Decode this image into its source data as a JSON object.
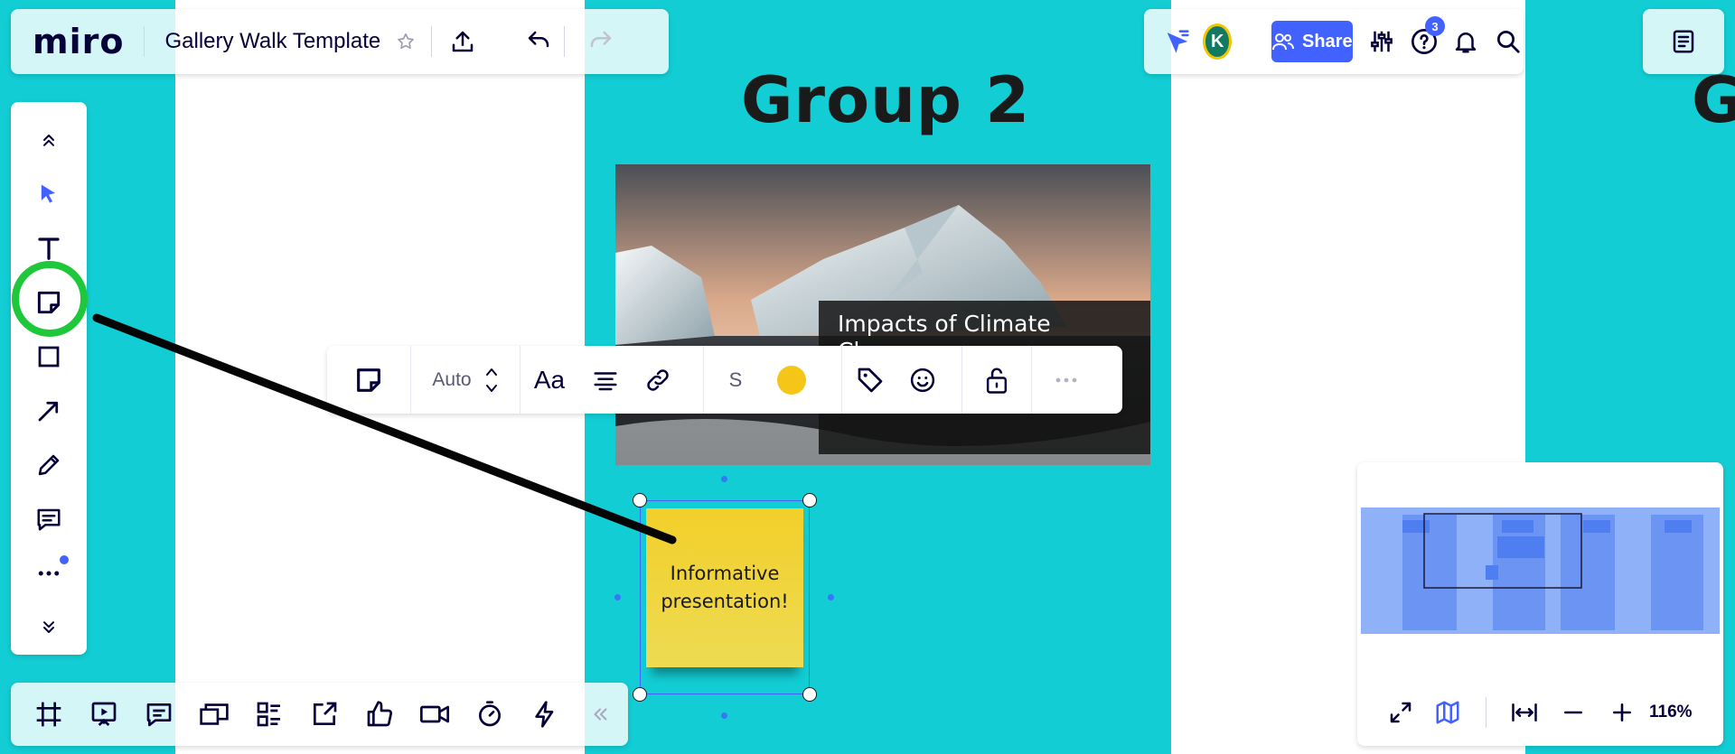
{
  "app": {
    "logo": "miro",
    "board_title": "Gallery Walk Template"
  },
  "canvas": {
    "frames": [
      {
        "title": "Group 2"
      },
      {
        "title": "G"
      }
    ],
    "image_caption": "Impacts of Climate Change",
    "sticky_note": {
      "line1": "Informative",
      "line2": "presentation!",
      "color": "#f2cf2a"
    },
    "background_color": "#12cdd4"
  },
  "topbar_right": {
    "avatar_initial": "K",
    "share_label": "Share",
    "help_badge": "3"
  },
  "left_toolbar": {
    "tools": [
      "collapse-up-icon",
      "select-icon",
      "text-icon",
      "sticky-note-icon",
      "shape-icon",
      "arrow-icon",
      "pen-icon",
      "comment-icon",
      "more-icon",
      "collapse-down-icon"
    ],
    "highlighted_tool": "sticky-note-icon"
  },
  "context_toolbar": {
    "size_value": "Auto",
    "font_label": "Aa",
    "shape_size_label": "S",
    "fill_color": "#f5c518"
  },
  "bottom_toolbar": {
    "tools": [
      "frames-icon",
      "presentation-icon",
      "notes-icon",
      "cards-icon",
      "kanban-icon",
      "export-icon",
      "voting-icon",
      "video-icon",
      "timer-icon",
      "lightning-icon",
      "collapse-left-icon"
    ]
  },
  "minimap": {
    "zoom_level": "116%"
  }
}
